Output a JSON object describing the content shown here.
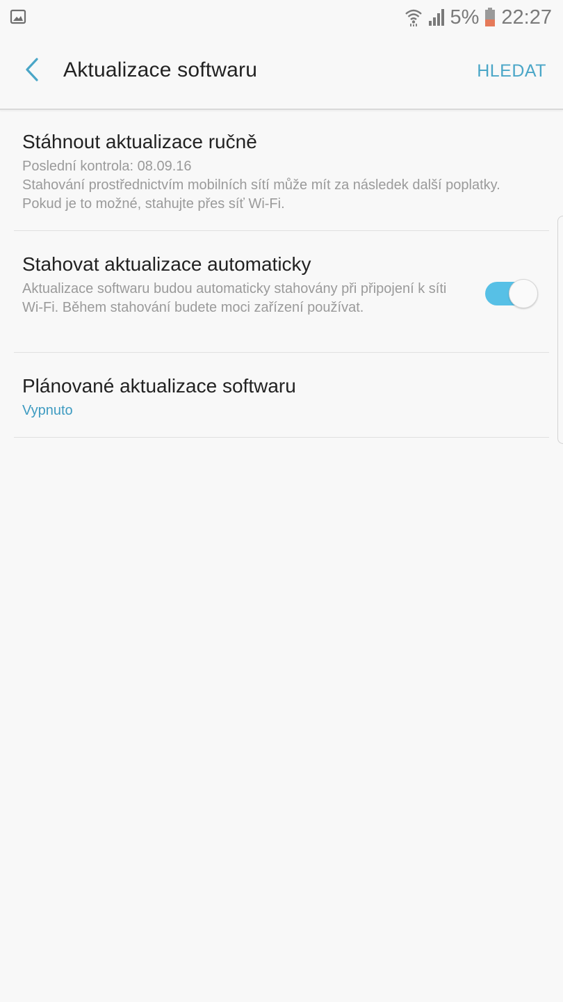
{
  "status_bar": {
    "left_icon": "gallery-notification-icon",
    "icons": [
      "wifi-icon",
      "signal-icon"
    ],
    "battery_percent": "5%",
    "battery_level": 0.05,
    "time": "22:27"
  },
  "app_bar": {
    "back_icon": "chevron-left-icon",
    "title": "Aktualizace softwaru",
    "search_label": "HLEDAT"
  },
  "settings": [
    {
      "title": "Stáhnout aktualizace ručně",
      "last_check": "Poslední kontrola: 08.09.16",
      "description": "Stahování prostřednictvím mobilních sítí může mít za následek další poplatky. Pokud je to možné, stahujte přes síť Wi-Fi."
    },
    {
      "title": "Stahovat aktualizace automaticky",
      "description": "Aktualizace softwaru budou automaticky stahovány při připojení k síti Wi-Fi. Během stahování budete moci zařízení používat.",
      "toggle_on": true
    },
    {
      "title": "Plánované aktualizace softwaru",
      "value": "Vypnuto"
    }
  ],
  "colors": {
    "accent": "#4aa6c7",
    "toggle_track": "#57c0e6",
    "background": "#f8f8f8",
    "battery_low": "#e57a5a"
  }
}
